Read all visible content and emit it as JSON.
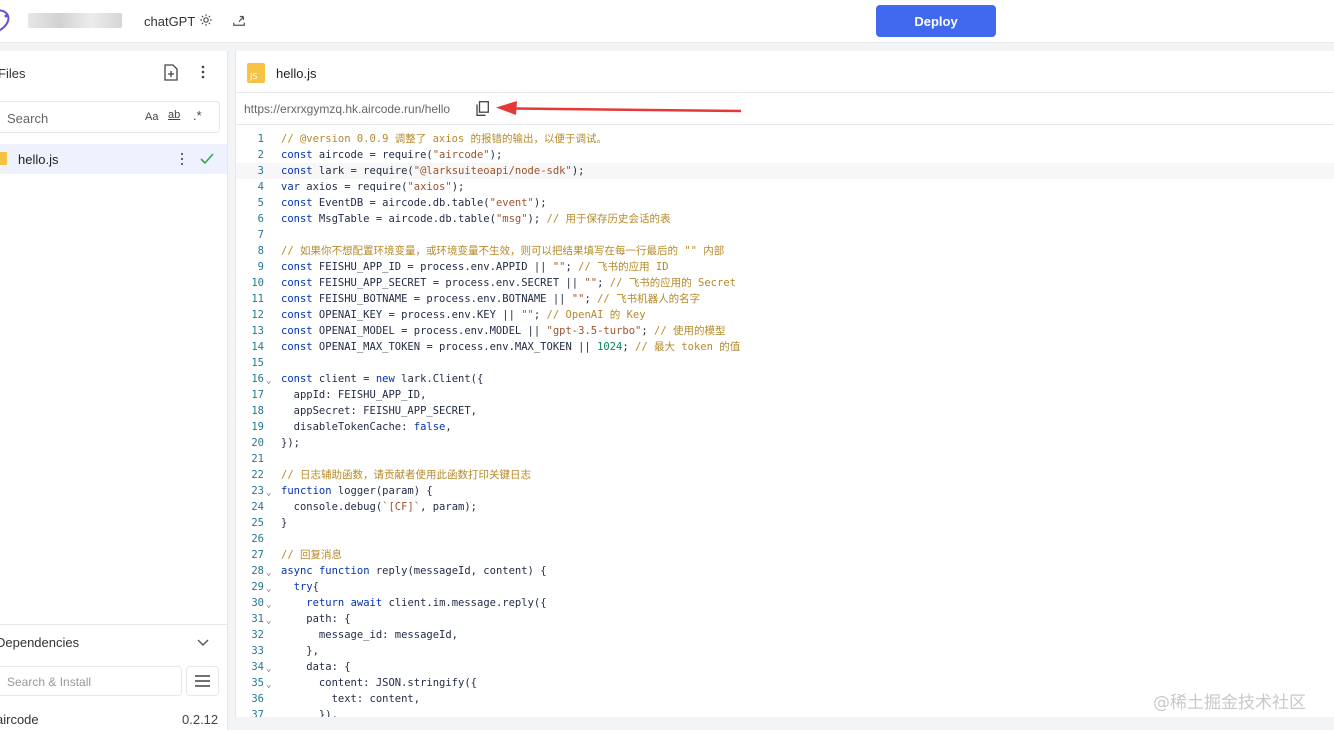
{
  "topbar": {
    "app_name": "chatGPT",
    "deploy_label": "Deploy",
    "accent": "#4169f0"
  },
  "sidebar": {
    "files_title": "Files",
    "search_placeholder": "Search",
    "search_options": {
      "match_case": "Aa",
      "whole_word": "ab",
      "regex": ".*"
    },
    "files": [
      {
        "name": "hello.js",
        "status": "saved"
      }
    ],
    "dependencies_title": "Dependencies",
    "deps_search_placeholder": "Search & Install",
    "dependencies": [
      {
        "name": "aircode",
        "version": "0.2.12"
      }
    ]
  },
  "editor": {
    "tab_label": "hello.js",
    "tab_icon_text": "JS",
    "url": "https://erxrxgymzq.hk.aircode.run/hello",
    "lines": [
      "// @version 0.0.9 调整了 axios 的报错的输出，以便于调试。",
      "const aircode = require(\"aircode\");",
      "const lark = require(\"@larksuiteoapi/node-sdk\");",
      "var axios = require(\"axios\");",
      "const EventDB = aircode.db.table(\"event\");",
      "const MsgTable = aircode.db.table(\"msg\"); // 用于保存历史会话的表",
      "",
      "// 如果你不想配置环境变量，或环境变量不生效，则可以把结果填写在每一行最后的 \"\" 内部",
      "const FEISHU_APP_ID = process.env.APPID || \"\"; // 飞书的应用 ID",
      "const FEISHU_APP_SECRET = process.env.SECRET || \"\"; // 飞书的应用的 Secret",
      "const FEISHU_BOTNAME = process.env.BOTNAME || \"\"; // 飞书机器人的名字",
      "const OPENAI_KEY = process.env.KEY || \"\"; // OpenAI 的 Key",
      "const OPENAI_MODEL = process.env.MODEL || \"gpt-3.5-turbo\"; // 使用的模型",
      "const OPENAI_MAX_TOKEN = process.env.MAX_TOKEN || 1024; // 最大 token 的值",
      "",
      "const client = new lark.Client({",
      "  appId: FEISHU_APP_ID,",
      "  appSecret: FEISHU_APP_SECRET,",
      "  disableTokenCache: false,",
      "});",
      "",
      "// 日志辅助函数，请贡献者使用此函数打印关键日志",
      "function logger(param) {",
      "  console.debug(`[CF]`, param);",
      "}",
      "",
      "// 回复消息",
      "async function reply(messageId, content) {",
      "  try{",
      "    return await client.im.message.reply({",
      "    path: {",
      "      message_id: messageId,",
      "    },",
      "    data: {",
      "      content: JSON.stringify({",
      "        text: content,",
      "      }),"
    ]
  },
  "watermark": "@稀土掘金技术社区"
}
